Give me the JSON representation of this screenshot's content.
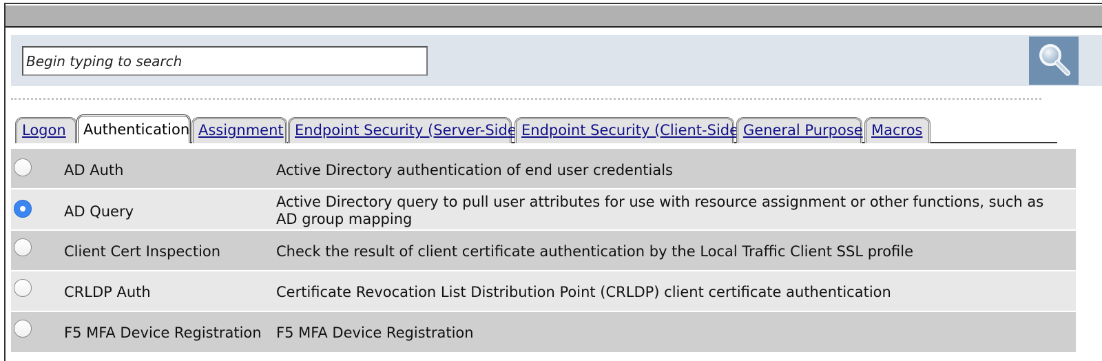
{
  "search": {
    "placeholder": "Begin typing to search"
  },
  "tabs": [
    {
      "label": "Logon",
      "active": false
    },
    {
      "label": "Authentication",
      "active": true
    },
    {
      "label": "Assignment",
      "active": false
    },
    {
      "label": "Endpoint Security (Server-Side)",
      "active": false
    },
    {
      "label": "Endpoint Security (Client-Side)",
      "active": false
    },
    {
      "label": "General Purpose",
      "active": false
    },
    {
      "label": "Macros",
      "active": false
    }
  ],
  "items": [
    {
      "name": "AD Auth",
      "description": "Active Directory authentication of end user credentials",
      "selected": false
    },
    {
      "name": "AD Query",
      "description": "Active Directory query to pull user attributes for use with resource assignment or other functions, such as AD group mapping",
      "selected": true
    },
    {
      "name": "Client Cert Inspection",
      "description": "Check the result of client certificate authentication by the Local Traffic Client SSL profile",
      "selected": false
    },
    {
      "name": "CRLDP Auth",
      "description": "Certificate Revocation List Distribution Point (CRLDP) client certificate authentication",
      "selected": false
    },
    {
      "name": "F5 MFA Device Registration",
      "description": "F5 MFA Device Registration",
      "selected": false
    }
  ],
  "icons": {
    "search_button": "magnifier-icon",
    "radio_selected_color": "#3b86f0"
  },
  "colors": {
    "search_strip": "#dde4ec",
    "search_button": "#6f8fb0",
    "row_dark": "#cfcfcf",
    "row_light": "#e8e8e8",
    "titlebar": "#b1b1b1",
    "link": "#11118a"
  }
}
